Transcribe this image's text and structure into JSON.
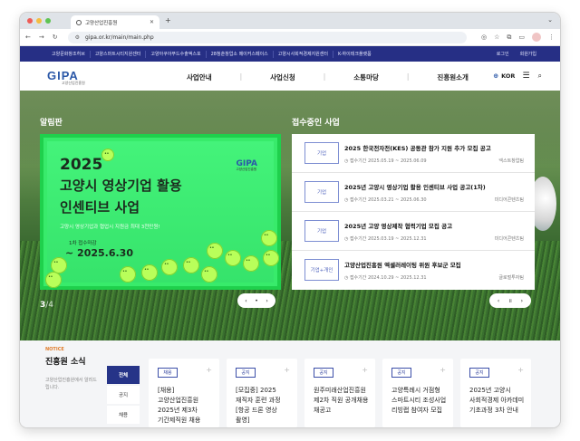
{
  "browser": {
    "tab_title": "고양산업진흥원",
    "url": "gipa.or.kr/main/main.php"
  },
  "topbar": {
    "links": [
      "고양문화창조허브",
      "고양스마트시티지원센터",
      "고양아쿠아푸드수출엑스포",
      "28청춘창업소 메이커스페이스",
      "고양시사회적경제지원센터",
      "K-하이테크플랫폼"
    ],
    "login": "로그인",
    "join": "회원가입"
  },
  "header": {
    "logo_text": "GIPA",
    "logo_sub": "고양산업진흥원",
    "menu": [
      "사업안내",
      "사업신청",
      "소통마당",
      "진흥원소개"
    ],
    "lang": "KOR"
  },
  "hero": {
    "notice_title": "알림판",
    "apply_title": "접수중인 사업",
    "banner": {
      "year": "2025",
      "line1": "고양시 영상기업 활용",
      "line2": "인센티브 사업",
      "desc": "고양시 영상기업과 협업시 지원금 최대 3천만원!",
      "round": "1차 접수마감",
      "date": "~ 2025.6.30",
      "logo": "GIPA",
      "logo_sub": "고양산업진흥원"
    },
    "pager_current": "3",
    "pager_total": "/4",
    "items": [
      {
        "badge": "기업",
        "title": "2025 한국전자전(KES) 공동관 참가 지원 추가 모집 공고",
        "period": "접수기간 2025.05.19 ~ 2025.06.09",
        "org": "넥스트창업팀"
      },
      {
        "badge": "기업",
        "title": "2025년 고양시 영상기업 활용 인센티브 사업 공고(1차)",
        "period": "접수기간 2025.03.21 ~ 2025.06.30",
        "org": "미디어콘텐츠팀"
      },
      {
        "badge": "기업",
        "title": "2025년 고양 영상제작 협력기업 모집 공고",
        "period": "접수기간 2025.03.19 ~ 2025.12.31",
        "org": "미디어콘텐츠팀"
      },
      {
        "badge": "기업+개인",
        "title": "고양산업진흥원 엑셀러레이팅 위원 후보군 모집",
        "period": "접수기간 2024.10.29 ~ 2025.12.31",
        "org": "글로벌투자팀"
      }
    ]
  },
  "notice": {
    "label": "NOTICE",
    "title": "진흥원 소식",
    "desc": "고양산업진흥원에서 알려드립니다.",
    "tabs": [
      "전체",
      "공지",
      "채용"
    ],
    "cards": [
      {
        "badge": "채용",
        "text": "[채용] 고양산업진흥원 2025년 제3차 기간제직원 채용"
      },
      {
        "badge": "공지",
        "text": "[모집중] 2025 재직자 훈련 과정 [항공 드론 영상 촬영]"
      },
      {
        "badge": "공지",
        "text": "원주미래산업진흥원 제2차 직원 공개채용 채공고"
      },
      {
        "badge": "공지",
        "text": "고양특례시 거점형 스마트시티 조성사업 리빙랩 참여자 모집"
      },
      {
        "badge": "공지",
        "text": "2025년 고양시 사회적경제 아카데미 기초과정 3차 안내"
      }
    ]
  }
}
